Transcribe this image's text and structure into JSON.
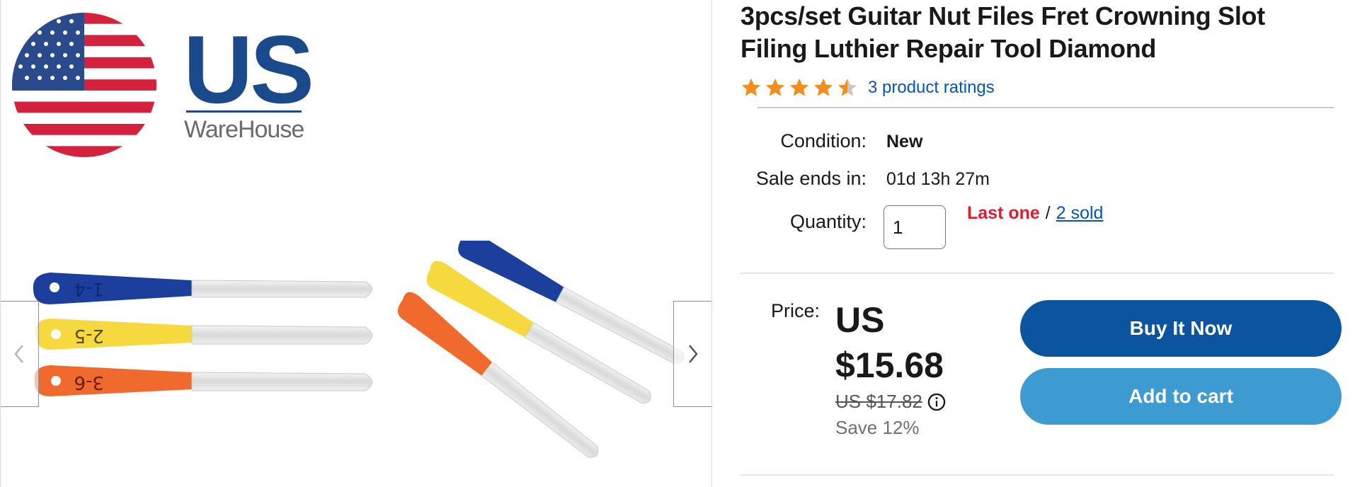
{
  "gallery": {
    "logo_text": "US",
    "logo_subtext": "WareHouse",
    "file_labels": [
      "1-4",
      "2-5",
      "3-6"
    ],
    "colors": {
      "brand_blue": "#1a4a8c",
      "file_blue": "#1c3f9e",
      "file_yellow": "#f6d93f",
      "file_orange": "#ef6a2c",
      "flag_red": "#d4213d"
    }
  },
  "product": {
    "title": "3pcs/set Guitar Nut Files Fret Crowning Slot Filing Luthier Repair Tool Diamond",
    "rating_stars": 4.5,
    "rating_text": "3 product ratings",
    "condition_label": "Condition:",
    "condition_value": "New",
    "sale_label": "Sale ends in:",
    "sale_value": "01d 13h 27m",
    "quantity_label": "Quantity:",
    "quantity_value": "1",
    "last_one": "Last one",
    "avail_sep": "/",
    "sold_text": "2 sold",
    "price_label": "Price:",
    "price_currency": "US",
    "price_value": "$15.68",
    "original_price": "US $17.82",
    "save_text": "Save 12%",
    "buy_now": "Buy It Now",
    "add_to_cart": "Add to cart"
  },
  "colors": {
    "accent_link": "#0654ba",
    "star": "#f18e1d",
    "alert_red": "#dd1e31",
    "buy_button": "#0a54a0",
    "cart_button": "#3e9bd1"
  }
}
